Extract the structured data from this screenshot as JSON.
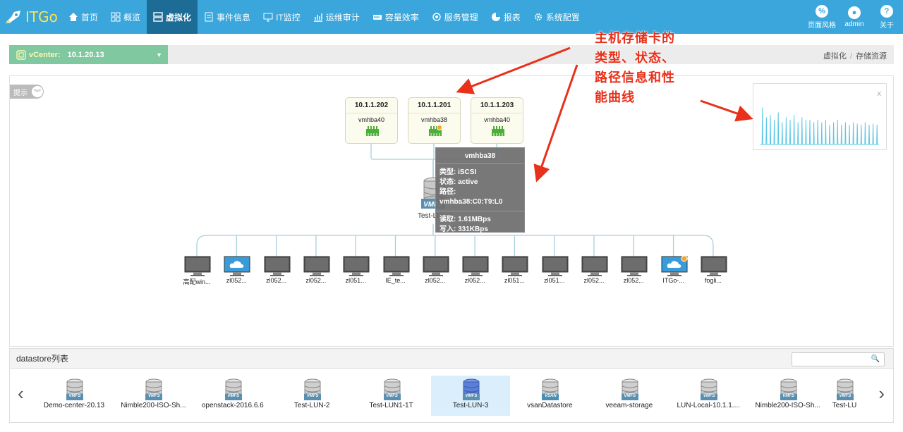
{
  "app": {
    "logo_text": "ITGo"
  },
  "nav": {
    "items": [
      {
        "label": "首页",
        "icon": "home-icon"
      },
      {
        "label": "概览",
        "icon": "grid-icon"
      },
      {
        "label": "虚拟化",
        "icon": "server-icon",
        "active": true
      },
      {
        "label": "事件信息",
        "icon": "document-icon"
      },
      {
        "label": "IT监控",
        "icon": "monitor-icon"
      },
      {
        "label": "运维审计",
        "icon": "chart-icon"
      },
      {
        "label": "容量效率",
        "icon": "storage-icon"
      },
      {
        "label": "服务管理",
        "icon": "service-icon"
      },
      {
        "label": "报表",
        "icon": "pie-icon"
      },
      {
        "label": "系统配置",
        "icon": "settings-icon"
      }
    ],
    "right": [
      {
        "label": "页面风格",
        "icon": "style-icon",
        "glyph": "%"
      },
      {
        "label": "admin",
        "icon": "user-icon",
        "glyph": "●"
      },
      {
        "label": "关于",
        "icon": "help-icon",
        "glyph": "?"
      }
    ]
  },
  "vcenter": {
    "label": "vCenter:",
    "value": "10.1.20.13"
  },
  "breadcrumb": {
    "parent": "虚拟化",
    "sep": "/",
    "current": "存储资源"
  },
  "topology": {
    "hint_label": "提示",
    "hosts": [
      {
        "ip": "10.1.1.202",
        "hba": "vmhba40",
        "warn": false
      },
      {
        "ip": "10.1.1.201",
        "hba": "vmhba38",
        "warn": true
      },
      {
        "ip": "10.1.1.203",
        "hba": "vmhba40",
        "warn": false
      }
    ],
    "tooltip": {
      "title": "vmhba38",
      "type": "类型: iSCSI",
      "status": "状态: active",
      "path": "路径: vmhba38:C0:T9:L0",
      "read": "读取: 1.61MBps",
      "write": "写入: 331KBps"
    },
    "lun": {
      "name": "Test-LUN-3",
      "badge": "VMFS"
    },
    "vms": [
      {
        "name": "高配win...",
        "cloud": false,
        "warn": false
      },
      {
        "name": "zl052...",
        "cloud": true,
        "warn": false
      },
      {
        "name": "zl052...",
        "cloud": false,
        "warn": false
      },
      {
        "name": "zl052...",
        "cloud": false,
        "warn": false
      },
      {
        "name": "zl051...",
        "cloud": false,
        "warn": false
      },
      {
        "name": "IE_te...",
        "cloud": false,
        "warn": false
      },
      {
        "name": "zl052...",
        "cloud": false,
        "warn": false
      },
      {
        "name": "zl052...",
        "cloud": false,
        "warn": false
      },
      {
        "name": "zl051...",
        "cloud": false,
        "warn": false
      },
      {
        "name": "zl051...",
        "cloud": false,
        "warn": false
      },
      {
        "name": "zl052...",
        "cloud": false,
        "warn": false
      },
      {
        "name": "zl052...",
        "cloud": false,
        "warn": false
      },
      {
        "name": "ITGo-...",
        "cloud": true,
        "warn": true
      },
      {
        "name": "fogli...",
        "cloud": false,
        "warn": false
      }
    ],
    "perf_close": "x",
    "perf_spikes": [
      0.75,
      0.55,
      0.6,
      0.5,
      0.65,
      0.45,
      0.55,
      0.5,
      0.6,
      0.45,
      0.55,
      0.5,
      0.5,
      0.45,
      0.5,
      0.45,
      0.5,
      0.4,
      0.45,
      0.5,
      0.4,
      0.45,
      0.4,
      0.45,
      0.42,
      0.4,
      0.45,
      0.4,
      0.42,
      0.4
    ],
    "chart_color": "#5bc8e6"
  },
  "annotation": {
    "lines": [
      "主机存储卡的",
      "类型、状态、",
      "路径信息和性",
      "能曲线"
    ]
  },
  "datastore": {
    "header": "datastore列表",
    "search_icon": "search-icon",
    "prev": "‹",
    "next": "›",
    "items": [
      {
        "name": "Demo-center-20.13",
        "badge": "VMFS",
        "selected": false
      },
      {
        "name": "Nimble200-ISO-Sh...",
        "badge": "VMFS",
        "selected": false
      },
      {
        "name": "openstack-2016.6.6",
        "badge": "VMFS",
        "selected": false
      },
      {
        "name": "Test-LUN-2",
        "badge": "VMFS",
        "selected": false
      },
      {
        "name": "Test-LUN1-1T",
        "badge": "VMFS",
        "selected": false
      },
      {
        "name": "Test-LUN-3",
        "badge": "VMFS",
        "selected": true
      },
      {
        "name": "vsanDatastore",
        "badge": "VSAN",
        "selected": false
      },
      {
        "name": "veeam-storage",
        "badge": "VMFS",
        "selected": false
      },
      {
        "name": "LUN-Local-10.1.1....",
        "badge": "VMFS",
        "selected": false
      },
      {
        "name": "Nimble200-ISO-Sh...",
        "badge": "VMFS",
        "selected": false
      },
      {
        "name": "Test-LU",
        "badge": "VMFS",
        "selected": false
      }
    ]
  },
  "colors": {
    "topbar": "#3aa6db",
    "nav_active": "#1d6c96",
    "vcenter": "#7fc8a0",
    "annotation": "#e8301a",
    "nic": "#4caf3a",
    "selected": "#dbeefb"
  }
}
